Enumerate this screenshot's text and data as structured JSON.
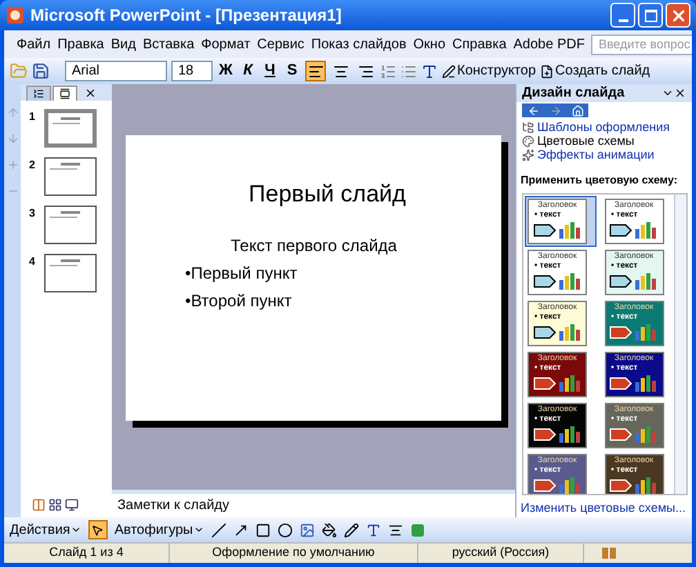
{
  "window": {
    "title": "Microsoft PowerPoint - [Презентация1]"
  },
  "menu": [
    "Файл",
    "Правка",
    "Вид",
    "Вставка",
    "Формат",
    "Сервис",
    "Показ слайдов",
    "Окно",
    "Справка",
    "Adobe PDF"
  ],
  "help_box": {
    "placeholder": "Введите вопрос"
  },
  "toolbar": {
    "font": "Arial",
    "size": "18",
    "format_buttons": [
      {
        "label": "Ж",
        "kind": "bold"
      },
      {
        "label": "К",
        "kind": "italic"
      },
      {
        "label": "Ч",
        "kind": "underline"
      },
      {
        "label": "S",
        "kind": "shadow"
      }
    ],
    "align": [
      {
        "kind": "left",
        "selected": true
      },
      {
        "kind": "center",
        "selected": false
      },
      {
        "kind": "right",
        "selected": false
      }
    ],
    "designer": "Конструктор",
    "new_slide": "Создать слайд"
  },
  "panel_tabs": [
    {
      "kind": "outline",
      "selected": false
    },
    {
      "kind": "slides",
      "selected": true
    }
  ],
  "thumbnails": [
    {
      "number": "1",
      "selected": true
    },
    {
      "number": "2",
      "selected": false
    },
    {
      "number": "3",
      "selected": false
    },
    {
      "number": "4",
      "selected": false
    }
  ],
  "slide": {
    "title": "Первый слайд",
    "subtitle": "Текст первого слайда",
    "bullets": [
      "•Первый пункт",
      "•Второй пункт"
    ]
  },
  "notes": {
    "placeholder": "Заметки к слайду"
  },
  "task_pane": {
    "title": "Дизайн слайда",
    "links": [
      {
        "kind": "templates",
        "label": "Шаблоны оформления",
        "selected": false
      },
      {
        "kind": "colors",
        "label": "Цветовые схемы",
        "selected": true
      },
      {
        "kind": "animation",
        "label": "Эффекты анимации",
        "selected": false
      }
    ],
    "section": "Применить цветовую схему:",
    "schemes": [
      {
        "title": "Заголовок",
        "bullet": "• текст",
        "color": "#ffffff",
        "selected": true
      },
      {
        "title": "Заголовок",
        "bullet": "• текст",
        "color": "#ffffff",
        "selected": false
      },
      {
        "title": "Заголовок",
        "bullet": "• текст",
        "color": "#ffffff",
        "selected": false
      },
      {
        "title": "Заголовок",
        "bullet": "• текст",
        "color": "#e4f6f2",
        "selected": false
      },
      {
        "title": "Заголовок",
        "bullet": "• текст",
        "color": "#fffbd6",
        "selected": false
      },
      {
        "title": "Заголовок",
        "bullet": "• текст",
        "color": "#0b7a74",
        "selected": false
      },
      {
        "title": "Заголовок",
        "bullet": "• текст",
        "color": "#7a0a0a",
        "selected": false
      },
      {
        "title": "Заголовок",
        "bullet": "• текст",
        "color": "#0a0a8a",
        "selected": false
      },
      {
        "title": "Заголовок",
        "bullet": "• текст",
        "color": "#050505",
        "selected": false
      },
      {
        "title": "Заголовок",
        "bullet": "• текст",
        "color": "#67665a",
        "selected": false
      },
      {
        "title": "Заголовок",
        "bullet": "• текст",
        "color": "#5a5a8c",
        "selected": false
      },
      {
        "title": "Заголовок",
        "bullet": "• текст",
        "color": "#4a3822",
        "selected": false
      }
    ],
    "footer_link": "Изменить цветовые схемы..."
  },
  "drawing_toolbar": {
    "actions": "Действия",
    "autoshapes": "Автофигуры"
  },
  "status_bar": [
    "Слайд 1 из 4",
    "Оформление по умолчанию",
    "русский (Россия)"
  ]
}
